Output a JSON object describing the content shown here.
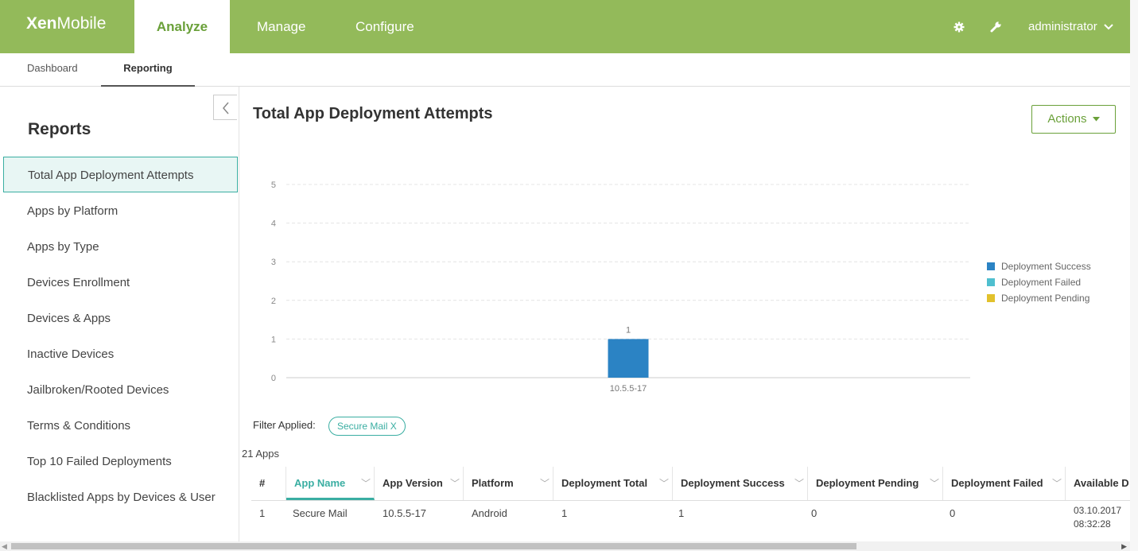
{
  "header": {
    "logo_bold": "Xen",
    "logo_light": "Mobile",
    "tabs": [
      {
        "label": "Analyze",
        "active": true
      },
      {
        "label": "Manage",
        "active": false
      },
      {
        "label": "Configure",
        "active": false
      }
    ],
    "user": "administrator",
    "icons": [
      "gear-icon",
      "wrench-icon",
      "chevron-down-icon"
    ],
    "brand_color": "#93ba5a"
  },
  "subtabs": [
    {
      "label": "Dashboard",
      "active": false
    },
    {
      "label": "Reporting",
      "active": true
    }
  ],
  "sidebar": {
    "title": "Reports",
    "items": [
      {
        "label": "Total App Deployment Attempts",
        "active": true
      },
      {
        "label": "Apps by Platform"
      },
      {
        "label": "Apps by Type"
      },
      {
        "label": "Devices Enrollment"
      },
      {
        "label": "Devices & Apps"
      },
      {
        "label": "Inactive Devices"
      },
      {
        "label": "Jailbroken/Rooted Devices"
      },
      {
        "label": "Terms & Conditions"
      },
      {
        "label": "Top 10 Failed Deployments"
      },
      {
        "label": "Blacklisted Apps by Devices & User"
      }
    ]
  },
  "main": {
    "title": "Total App Deployment Attempts",
    "actions_label": "Actions"
  },
  "chart_data": {
    "type": "bar",
    "categories": [
      "10.5.5-17"
    ],
    "series": [
      {
        "name": "Deployment Success",
        "values": [
          1
        ],
        "color": "#2b83c4"
      },
      {
        "name": "Deployment Failed",
        "values": [
          0
        ],
        "color": "#4fbfcf"
      },
      {
        "name": "Deployment Pending",
        "values": [
          0
        ],
        "color": "#e2c12c"
      }
    ],
    "data_labels": [
      "1"
    ],
    "yticks": [
      "0",
      "1",
      "2",
      "3",
      "4",
      "5"
    ],
    "ylim": [
      0,
      5
    ],
    "grid": true,
    "legend": "right"
  },
  "filter": {
    "label": "Filter Applied:",
    "chip": "Secure Mail  X"
  },
  "count_text": "21 Apps",
  "table": {
    "columns": [
      "#",
      "App Name",
      "App Version",
      "Platform",
      "Deployment Total",
      "Deployment Success",
      "Deployment Pending",
      "Deployment Failed",
      "Available D"
    ],
    "sorted_column": "App Name",
    "rows": [
      [
        "1",
        "Secure Mail",
        "10.5.5-17",
        "Android",
        "1",
        "1",
        "0",
        "0",
        "03.10.2017",
        "08:32:28"
      ]
    ]
  }
}
